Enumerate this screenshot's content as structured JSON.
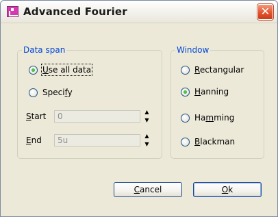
{
  "window": {
    "title": "Advanced Fourier",
    "icon": "chart-icon",
    "close_icon": "close-icon",
    "close_glyph": "✕"
  },
  "data_span": {
    "legend": "Data span",
    "use_all": {
      "prefix": "",
      "accel": "U",
      "rest": "se all data",
      "checked": true
    },
    "specify": {
      "prefix": "Speci",
      "accel": "f",
      "rest": "y",
      "checked": false
    },
    "start": {
      "accel": "S",
      "rest": "tart",
      "value": "0"
    },
    "end": {
      "accel": "E",
      "rest": "nd",
      "value": "5u"
    },
    "spin_up": "▲",
    "spin_down": "▼"
  },
  "window_group": {
    "legend": "Window",
    "options": [
      {
        "prefix": "",
        "accel": "R",
        "rest": "ectangular",
        "checked": false
      },
      {
        "prefix": "",
        "accel": "H",
        "rest": "anning",
        "checked": true
      },
      {
        "prefix": "Ha",
        "accel": "m",
        "rest": "ming",
        "checked": false
      },
      {
        "prefix": "",
        "accel": "B",
        "rest": "lackman",
        "checked": false
      }
    ]
  },
  "buttons": {
    "cancel": {
      "accel": "C",
      "rest": "ancel"
    },
    "ok": {
      "accel": "O",
      "rest": "k"
    }
  },
  "colors": {
    "legend_text": "#0046d5",
    "dialog_bg": "#ece9d8",
    "close_red": "#e2542e",
    "radio_green": "#21a121"
  }
}
